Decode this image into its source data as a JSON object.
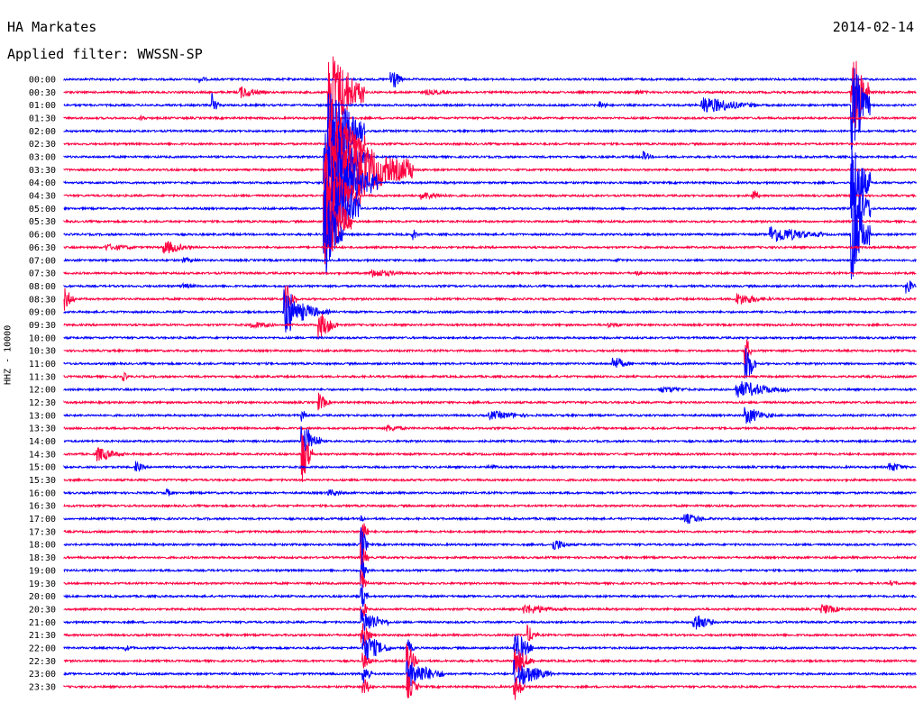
{
  "header": {
    "station": "HA Markates",
    "filter": "Applied filter: WWSSN-SP",
    "date": "2014-02-14"
  },
  "chart_data": {
    "type": "line",
    "title": "HA Markates",
    "subtitle": "Applied filter: WWSSN-SP",
    "date": "2014-02-14",
    "ylabel": "HHZ - 10000",
    "row_labels": [
      "00:00",
      "00:30",
      "01:00",
      "01:30",
      "02:00",
      "02:30",
      "03:00",
      "03:30",
      "04:00",
      "04:30",
      "05:00",
      "05:30",
      "06:00",
      "06:30",
      "07:00",
      "07:30",
      "08:00",
      "08:30",
      "09:00",
      "09:30",
      "10:00",
      "10:30",
      "11:00",
      "11:30",
      "12:00",
      "12:30",
      "13:00",
      "13:30",
      "14:00",
      "14:30",
      "15:00",
      "15:30",
      "16:00",
      "16:30",
      "17:00",
      "17:30",
      "18:00",
      "18:30",
      "19:00",
      "19:30",
      "20:00",
      "20:30",
      "21:00",
      "21:30",
      "22:00",
      "22:30",
      "23:00",
      "23:30"
    ],
    "colors": [
      "#0000ff",
      "#ff0040"
    ],
    "events": [
      {
        "row": 0,
        "x": 0.16,
        "amp": 4,
        "dur": 0.01
      },
      {
        "row": 0,
        "x": 0.385,
        "amp": 14,
        "dur": 0.01
      },
      {
        "row": 1,
        "x": 0.207,
        "amp": 7,
        "dur": 0.03
      },
      {
        "row": 1,
        "x": 0.311,
        "amp": 50,
        "dur": 0.04
      },
      {
        "row": 1,
        "x": 0.425,
        "amp": 3,
        "dur": 0.05
      },
      {
        "row": 1,
        "x": 0.672,
        "amp": 3,
        "dur": 0.02
      },
      {
        "row": 1,
        "x": 0.925,
        "amp": 50,
        "dur": 0.02
      },
      {
        "row": 2,
        "x": 0.175,
        "amp": 14,
        "dur": 0.005
      },
      {
        "row": 2,
        "x": 0.63,
        "amp": 5,
        "dur": 0.01
      },
      {
        "row": 2,
        "x": 0.75,
        "amp": 10,
        "dur": 0.06
      },
      {
        "row": 2,
        "x": 0.925,
        "amp": 50,
        "dur": 0.02
      },
      {
        "row": 3,
        "x": 0.09,
        "amp": 3,
        "dur": 0.01
      },
      {
        "row": 4,
        "x": 0.311,
        "amp": 50,
        "dur": 0.04
      },
      {
        "row": 5,
        "x": 0.311,
        "amp": 50,
        "dur": 0.04
      },
      {
        "row": 6,
        "x": 0.308,
        "amp": 50,
        "dur": 0.05
      },
      {
        "row": 6,
        "x": 0.68,
        "amp": 6,
        "dur": 0.01
      },
      {
        "row": 7,
        "x": 0.308,
        "amp": 50,
        "dur": 0.1
      },
      {
        "row": 8,
        "x": 0.306,
        "amp": 50,
        "dur": 0.06
      },
      {
        "row": 8,
        "x": 0.925,
        "amp": 50,
        "dur": 0.02
      },
      {
        "row": 9,
        "x": 0.306,
        "amp": 50,
        "dur": 0.04
      },
      {
        "row": 9,
        "x": 0.42,
        "amp": 5,
        "dur": 0.04
      },
      {
        "row": 9,
        "x": 0.81,
        "amp": 7,
        "dur": 0.005
      },
      {
        "row": 10,
        "x": 0.306,
        "amp": 50,
        "dur": 0.04
      },
      {
        "row": 10,
        "x": 0.925,
        "amp": 50,
        "dur": 0.02
      },
      {
        "row": 11,
        "x": 0.306,
        "amp": 50,
        "dur": 0.03
      },
      {
        "row": 12,
        "x": 0.306,
        "amp": 50,
        "dur": 0.02
      },
      {
        "row": 12,
        "x": 0.41,
        "amp": 6,
        "dur": 0.005
      },
      {
        "row": 12,
        "x": 0.83,
        "amp": 10,
        "dur": 0.06
      },
      {
        "row": 12,
        "x": 0.925,
        "amp": 50,
        "dur": 0.02
      },
      {
        "row": 13,
        "x": 0.05,
        "amp": 4,
        "dur": 0.05
      },
      {
        "row": 13,
        "x": 0.118,
        "amp": 8,
        "dur": 0.03
      },
      {
        "row": 14,
        "x": 0.14,
        "amp": 3,
        "dur": 0.03
      },
      {
        "row": 14,
        "x": 0.65,
        "amp": 3,
        "dur": 0.01
      },
      {
        "row": 15,
        "x": 0.36,
        "amp": 5,
        "dur": 0.05
      },
      {
        "row": 15,
        "x": 0.67,
        "amp": 4,
        "dur": 0.01
      },
      {
        "row": 16,
        "x": 0.14,
        "amp": 3,
        "dur": 0.03
      },
      {
        "row": 16,
        "x": 0.99,
        "amp": 8,
        "dur": 0.01
      },
      {
        "row": 17,
        "x": 0.0,
        "amp": 14,
        "dur": 0.01
      },
      {
        "row": 17,
        "x": 0.26,
        "amp": 20,
        "dur": 0.01
      },
      {
        "row": 17,
        "x": 0.79,
        "amp": 7,
        "dur": 0.04
      },
      {
        "row": 18,
        "x": 0.26,
        "amp": 30,
        "dur": 0.02
      },
      {
        "row": 18,
        "x": 0.28,
        "amp": 10,
        "dur": 0.03
      },
      {
        "row": 19,
        "x": 0.22,
        "amp": 4,
        "dur": 0.04
      },
      {
        "row": 19,
        "x": 0.3,
        "amp": 15,
        "dur": 0.02
      },
      {
        "row": 19,
        "x": 0.64,
        "amp": 3,
        "dur": 0.03
      },
      {
        "row": 21,
        "x": 0.8,
        "amp": 20,
        "dur": 0.005
      },
      {
        "row": 22,
        "x": 0.645,
        "amp": 8,
        "dur": 0.02
      },
      {
        "row": 22,
        "x": 0.8,
        "amp": 25,
        "dur": 0.01
      },
      {
        "row": 23,
        "x": 0.07,
        "amp": 5,
        "dur": 0.005
      },
      {
        "row": 24,
        "x": 0.7,
        "amp": 4,
        "dur": 0.05
      },
      {
        "row": 24,
        "x": 0.79,
        "amp": 10,
        "dur": 0.06
      },
      {
        "row": 25,
        "x": 0.3,
        "amp": 10,
        "dur": 0.01
      },
      {
        "row": 26,
        "x": 0.28,
        "amp": 6,
        "dur": 0.005
      },
      {
        "row": 26,
        "x": 0.5,
        "amp": 5,
        "dur": 0.06
      },
      {
        "row": 26,
        "x": 0.8,
        "amp": 10,
        "dur": 0.03
      },
      {
        "row": 27,
        "x": 0.38,
        "amp": 4,
        "dur": 0.03
      },
      {
        "row": 28,
        "x": 0.28,
        "amp": 20,
        "dur": 0.02
      },
      {
        "row": 29,
        "x": 0.04,
        "amp": 8,
        "dur": 0.03
      },
      {
        "row": 29,
        "x": 0.28,
        "amp": 30,
        "dur": 0.01
      },
      {
        "row": 30,
        "x": 0.085,
        "amp": 6,
        "dur": 0.01
      },
      {
        "row": 30,
        "x": 0.5,
        "amp": 3,
        "dur": 0.02
      },
      {
        "row": 30,
        "x": 0.97,
        "amp": 6,
        "dur": 0.02
      },
      {
        "row": 32,
        "x": 0.12,
        "amp": 5,
        "dur": 0.01
      },
      {
        "row": 32,
        "x": 0.31,
        "amp": 4,
        "dur": 0.03
      },
      {
        "row": 34,
        "x": 0.35,
        "amp": 3,
        "dur": 0.01
      },
      {
        "row": 34,
        "x": 0.73,
        "amp": 6,
        "dur": 0.03
      },
      {
        "row": 35,
        "x": 0.35,
        "amp": 20,
        "dur": 0.005
      },
      {
        "row": 36,
        "x": 0.35,
        "amp": 20,
        "dur": 0.005
      },
      {
        "row": 36,
        "x": 0.575,
        "amp": 7,
        "dur": 0.02
      },
      {
        "row": 37,
        "x": 0.35,
        "amp": 14,
        "dur": 0.005
      },
      {
        "row": 38,
        "x": 0.35,
        "amp": 14,
        "dur": 0.005
      },
      {
        "row": 39,
        "x": 0.35,
        "amp": 14,
        "dur": 0.005
      },
      {
        "row": 39,
        "x": 0.97,
        "amp": 3,
        "dur": 0.02
      },
      {
        "row": 40,
        "x": 0.35,
        "amp": 14,
        "dur": 0.005
      },
      {
        "row": 41,
        "x": 0.35,
        "amp": 14,
        "dur": 0.005
      },
      {
        "row": 41,
        "x": 0.54,
        "amp": 6,
        "dur": 0.05
      },
      {
        "row": 41,
        "x": 0.89,
        "amp": 6,
        "dur": 0.03
      },
      {
        "row": 42,
        "x": 0.35,
        "amp": 14,
        "dur": 0.03
      },
      {
        "row": 42,
        "x": 0.74,
        "amp": 12,
        "dur": 0.02
      },
      {
        "row": 43,
        "x": 0.35,
        "amp": 14,
        "dur": 0.01
      },
      {
        "row": 43,
        "x": 0.545,
        "amp": 10,
        "dur": 0.01
      },
      {
        "row": 44,
        "x": 0.072,
        "amp": 3,
        "dur": 0.02
      },
      {
        "row": 44,
        "x": 0.352,
        "amp": 16,
        "dur": 0.03
      },
      {
        "row": 44,
        "x": 0.404,
        "amp": 10,
        "dur": 0.005
      },
      {
        "row": 44,
        "x": 0.53,
        "amp": 18,
        "dur": 0.02
      },
      {
        "row": 45,
        "x": 0.352,
        "amp": 8,
        "dur": 0.01
      },
      {
        "row": 45,
        "x": 0.404,
        "amp": 16,
        "dur": 0.01
      },
      {
        "row": 45,
        "x": 0.53,
        "amp": 16,
        "dur": 0.02
      },
      {
        "row": 46,
        "x": 0.352,
        "amp": 12,
        "dur": 0.01
      },
      {
        "row": 46,
        "x": 0.404,
        "amp": 16,
        "dur": 0.04
      },
      {
        "row": 46,
        "x": 0.53,
        "amp": 16,
        "dur": 0.04
      },
      {
        "row": 47,
        "x": 0.352,
        "amp": 10,
        "dur": 0.01
      },
      {
        "row": 47,
        "x": 0.404,
        "amp": 14,
        "dur": 0.01
      },
      {
        "row": 47,
        "x": 0.53,
        "amp": 14,
        "dur": 0.01
      }
    ]
  }
}
